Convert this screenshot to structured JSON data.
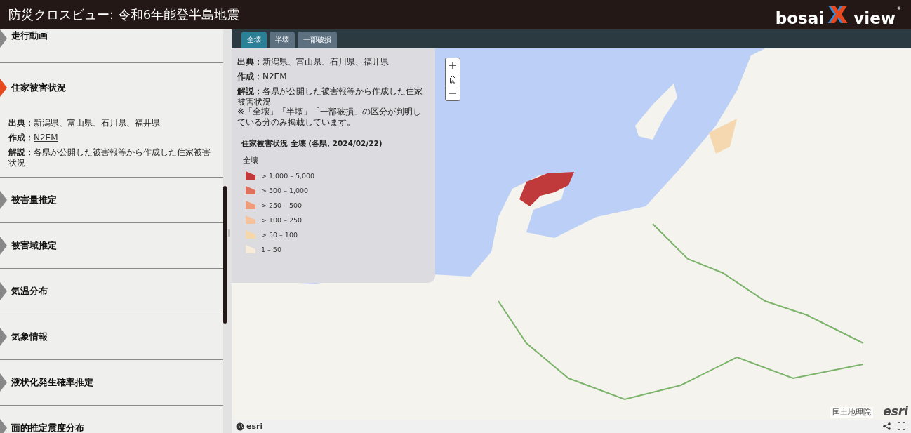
{
  "header": {
    "title": "防災クロスビュー: 令和6年能登半島地震",
    "logo": {
      "left": "bosai",
      "mark": "X",
      "right": "view",
      "trademark": "®"
    }
  },
  "sidebar": {
    "items": [
      {
        "label": "走行動画",
        "selected": false
      },
      {
        "label": "住家被害状況",
        "selected": true,
        "details": [
          {
            "label": "出典：",
            "value": "新潟県、富山県、石川県、福井県",
            "kind": "text"
          },
          {
            "label": "作成：",
            "value": "N2EM",
            "kind": "link"
          },
          {
            "label": "解説：",
            "value": "各県が公開した被害報等から作成した住家被害状況",
            "kind": "text"
          }
        ]
      },
      {
        "label": "被害量推定",
        "selected": false
      },
      {
        "label": "被害域推定",
        "selected": false
      },
      {
        "label": "気温分布",
        "selected": false
      },
      {
        "label": "気象情報",
        "selected": false
      },
      {
        "label": "液状化発生確率推定",
        "selected": false
      },
      {
        "label": "面的推定震度分布",
        "selected": false
      }
    ]
  },
  "map": {
    "tabs": [
      {
        "label": "全壊",
        "selected": true
      },
      {
        "label": "半壊",
        "selected": false
      },
      {
        "label": "一部破損",
        "selected": false
      }
    ],
    "info": {
      "details": [
        {
          "label": "出典：",
          "value": "新潟県、富山県、石川県、福井県"
        },
        {
          "label": "作成：",
          "value": "N2EM"
        },
        {
          "label": "解説：",
          "value": "各県が公開した被害報等から作成した住家被害状況"
        }
      ],
      "note": "※「全壊」「半壊」「一部破損」の区分が判明している分のみ掲載しています。",
      "legend": {
        "title": "住家被害状況 全壊 (各県, 2024/02/22)",
        "field": "全壊",
        "classes": [
          {
            "label": "> 1,000 – 5,000",
            "color": "#c0393b"
          },
          {
            "label": "> 500 – 1,000",
            "color": "#e0705e"
          },
          {
            "label": "> 250 – 500",
            "color": "#f09c7a"
          },
          {
            "label": "> 100 – 250",
            "color": "#f5c29c"
          },
          {
            "label": "> 50 – 100",
            "color": "#f6d6ab"
          },
          {
            "label": "1 – 50",
            "color": "#f7ebda"
          }
        ]
      }
    },
    "attribution": "国土地理院",
    "corner_logo": "esri"
  },
  "footer": {
    "logo": "esri"
  }
}
